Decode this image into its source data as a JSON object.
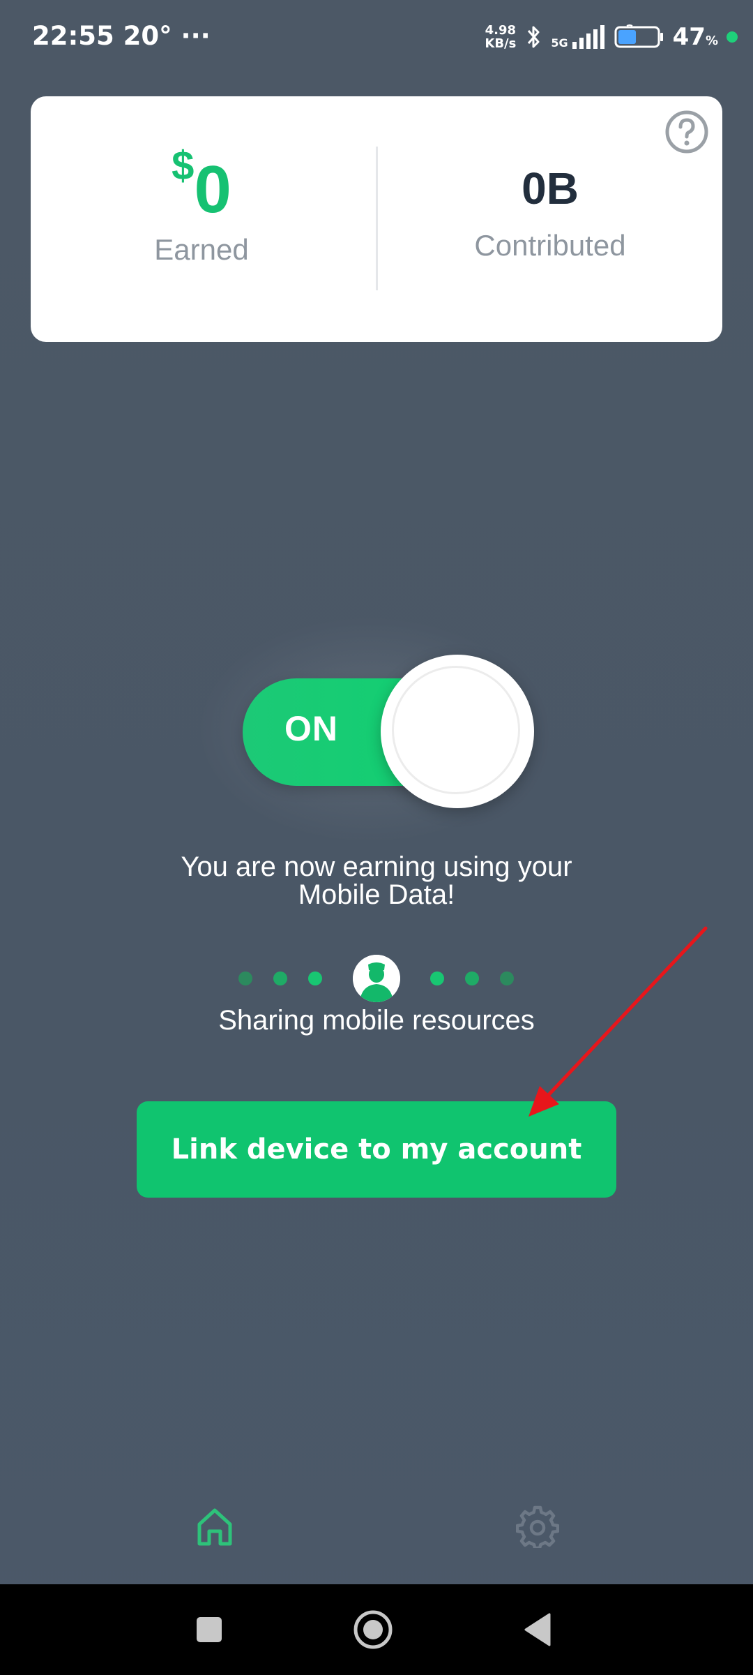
{
  "status_bar": {
    "time": "22:55 20° ···",
    "net_speed_value": "4.98",
    "net_speed_unit": "KB/s",
    "network_type": "5G",
    "battery_percent": "47",
    "battery_percent_sign": "%",
    "battery_level": 0.47,
    "status_dot_color": "#1ed07a"
  },
  "stats_card": {
    "earned": {
      "currency": "$",
      "amount": "0",
      "label": "Earned"
    },
    "contributed": {
      "value": "0B",
      "label": "Contributed"
    },
    "help_icon": "help-circle-icon"
  },
  "toggle": {
    "label": "ON",
    "state": "on",
    "color": "#14cc72"
  },
  "status_message_line1": "You are now earning using your",
  "status_message_line2": "Mobile Data!",
  "sharing": {
    "label": "Sharing mobile resources",
    "dot_colors": [
      "#2c8a5e",
      "#1fab66",
      "#18c672",
      "#18c672",
      "#1fab66",
      "#2c8a5e"
    ]
  },
  "cta_button": {
    "label": "Link device to my account",
    "color": "#10c46f"
  },
  "annotation_arrow_color": "#e8161b",
  "bottom_tabs": [
    {
      "name": "home",
      "icon": "home-icon",
      "active": true,
      "color": "#2ec27a"
    },
    {
      "name": "settings",
      "icon": "gear-icon",
      "active": false,
      "color": "#6d7886"
    }
  ],
  "nav_bar": {
    "buttons": [
      "recents-square-icon",
      "home-circle-icon",
      "back-triangle-icon"
    ]
  },
  "colors": {
    "background": "#4c5866",
    "accent_green": "#16c172",
    "card": "#ffffff",
    "dark_text": "#222e3d",
    "muted_text": "#8e969f"
  }
}
